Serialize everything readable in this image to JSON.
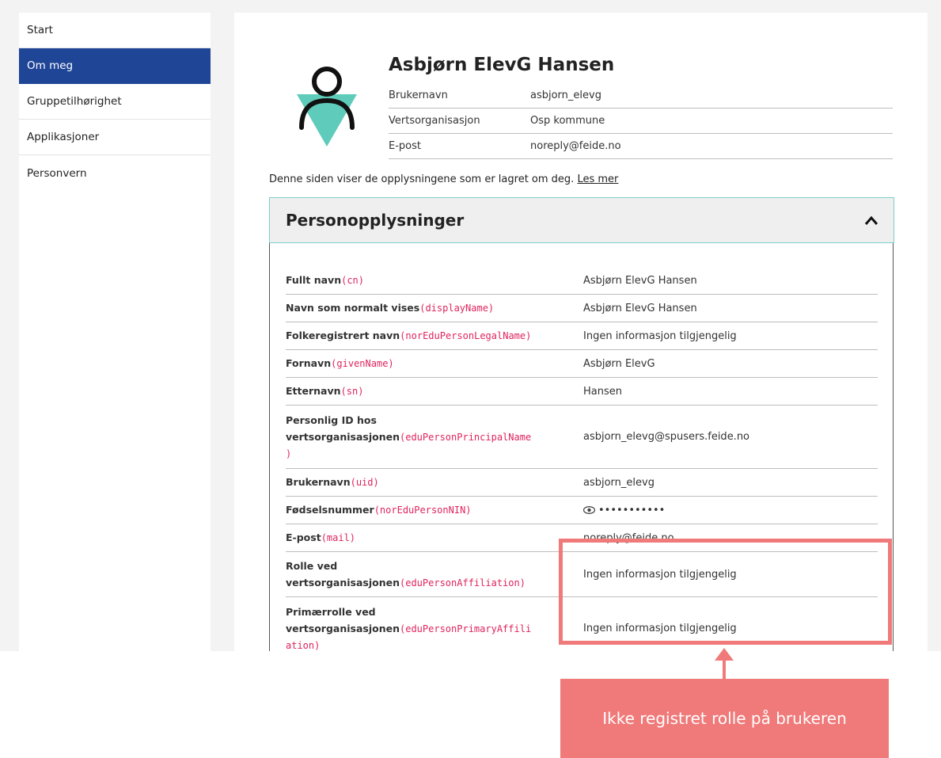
{
  "sidebar": {
    "items": [
      {
        "label": "Start"
      },
      {
        "label": "Om meg"
      },
      {
        "label": "Gruppetilhørighet"
      },
      {
        "label": "Applikasjoner"
      },
      {
        "label": "Personvern"
      }
    ]
  },
  "profile": {
    "name": "Asbjørn ElevG Hansen",
    "fields": [
      {
        "label": "Brukernavn",
        "value": "asbjorn_elevg"
      },
      {
        "label": "Vertsorganisasjon",
        "value": "Osp kommune"
      },
      {
        "label": "E-post",
        "value": "noreply@feide.no"
      }
    ]
  },
  "intro": {
    "text": "Denne siden viser de opplysningene som er lagret om deg. ",
    "link": "Les mer"
  },
  "panel": {
    "title": "Personopplysninger",
    "rows": [
      {
        "label": "Fullt navn",
        "key": "(cn)",
        "value": "Asbjørn ElevG Hansen"
      },
      {
        "label": "Navn som normalt vises",
        "key": "(displayName)",
        "value": "Asbjørn ElevG Hansen"
      },
      {
        "label": "Folkeregistrert navn",
        "key": "(norEduPersonLegalName)",
        "value": "Ingen informasjon tilgjengelig"
      },
      {
        "label": "Fornavn",
        "key": "(givenName)",
        "value": "Asbjørn ElevG"
      },
      {
        "label": "Etternavn",
        "key": "(sn)",
        "value": "Hansen"
      },
      {
        "label_1": "Personlig ID hos",
        "label_2": "vertsorganisasjonen",
        "key_1": "(eduPersonPrincipalName",
        "key_2": ")",
        "value": "asbjorn_elevg@spusers.feide.no"
      },
      {
        "label": "Brukernavn",
        "key": "(uid)",
        "value": "asbjorn_elevg"
      },
      {
        "label": "Fødselsnummer",
        "key": "(norEduPersonNIN)",
        "value": "•••••••••••"
      },
      {
        "label": "E-post",
        "key": "(mail)",
        "value": "noreply@feide.no"
      },
      {
        "label_1": "Rolle ved",
        "label_2": "vertsorganisasjonen",
        "key": "(eduPersonAffiliation)",
        "value": "Ingen informasjon tilgjengelig"
      },
      {
        "label_1": "Primærrolle ved",
        "label_2": "vertsorganisasjonen",
        "key_1": "(eduPersonPrimaryAffili",
        "key_2": "ation)",
        "value": "Ingen informasjon tilgjengelig"
      }
    ]
  },
  "callout": {
    "text": "Ikke registret rolle på brukeren"
  },
  "colors": {
    "sidebar_active": "#1f4597",
    "attribute_key": "#e0245e",
    "annotation": "#f07a7a",
    "avatar_triangle": "#5fcbbb"
  },
  "icons": [
    "user-avatar-icon",
    "chevron-up-icon",
    "eye-icon"
  ]
}
